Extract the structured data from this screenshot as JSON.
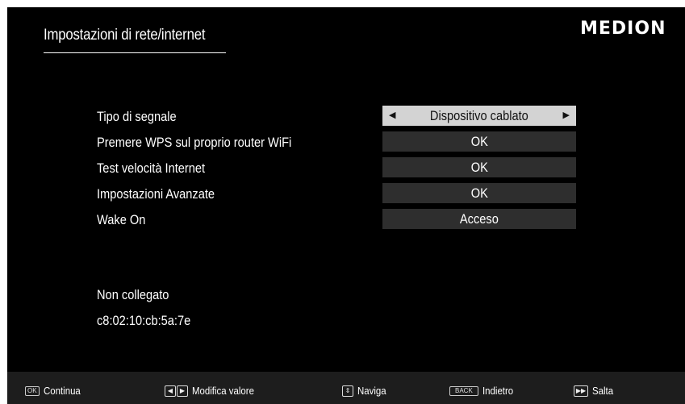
{
  "header": {
    "title": "Impostazioni di rete/internet",
    "logo": "MEDION"
  },
  "settings": [
    {
      "label": "Tipo di segnale",
      "value": "Dispositivo cablato",
      "selected": true
    },
    {
      "label": "Premere WPS sul proprio router WiFi",
      "value": "OK"
    },
    {
      "label": "Test velocità Internet",
      "value": "OK"
    },
    {
      "label": "Impostazioni Avanzate",
      "value": "OK"
    },
    {
      "label": "Wake On",
      "value": "Acceso"
    }
  ],
  "status": {
    "connection": "Non collegato",
    "mac": "c8:02:10:cb:5a:7e"
  },
  "footer": {
    "ok_key": "OK",
    "continue": "Continua",
    "modify": "Modifica valore",
    "navigate": "Naviga",
    "back_key": "BACK",
    "back": "Indietro",
    "skip": "Salta"
  },
  "colors": {
    "background": "#000000",
    "selected_box": "#d3d3d3",
    "value_box": "#2e2e2e",
    "footer_bar": "#1d1d1d"
  }
}
